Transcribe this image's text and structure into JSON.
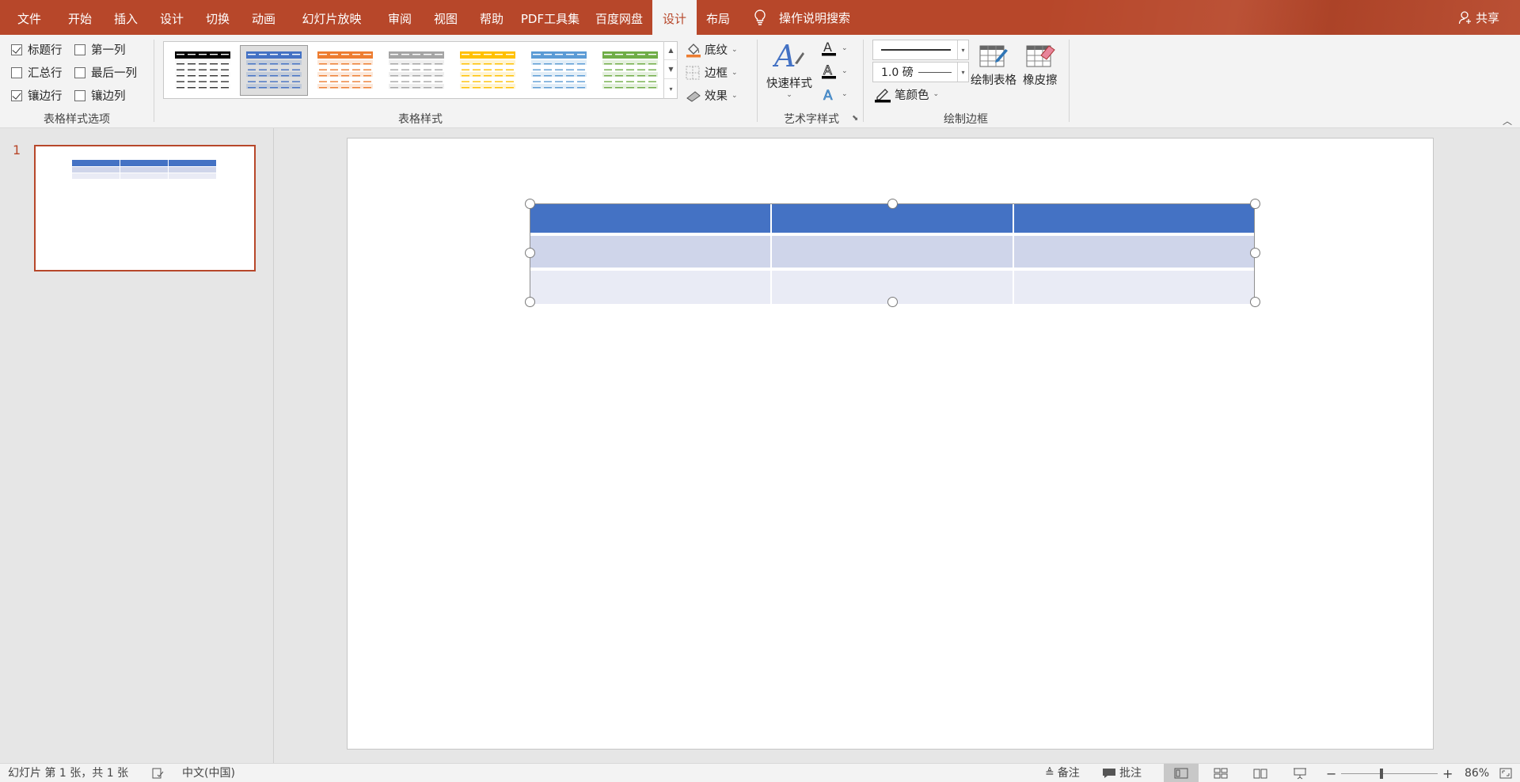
{
  "tabs": [
    {
      "label": "文件",
      "active": false
    },
    {
      "label": "开始",
      "active": false
    },
    {
      "label": "插入",
      "active": false
    },
    {
      "label": "设计",
      "active": false
    },
    {
      "label": "切换",
      "active": false
    },
    {
      "label": "动画",
      "active": false
    },
    {
      "label": "幻灯片放映",
      "active": false
    },
    {
      "label": "审阅",
      "active": false
    },
    {
      "label": "视图",
      "active": false
    },
    {
      "label": "帮助",
      "active": false
    },
    {
      "label": "PDF工具集",
      "active": false
    },
    {
      "label": "百度网盘",
      "active": false
    },
    {
      "label": "设计",
      "active": true
    },
    {
      "label": "布局",
      "active": false
    }
  ],
  "tell_me": "操作说明搜索",
  "share": "共享",
  "style_options": {
    "group_label": "表格样式选项",
    "items": [
      {
        "label": "标题行",
        "checked": true
      },
      {
        "label": "第一列",
        "checked": false
      },
      {
        "label": "汇总行",
        "checked": false
      },
      {
        "label": "最后一列",
        "checked": false
      },
      {
        "label": "镶边行",
        "checked": true
      },
      {
        "label": "镶边列",
        "checked": false
      }
    ]
  },
  "table_styles": {
    "group_label": "表格样式",
    "colors": [
      "#000000",
      "#4472c4",
      "#ed7d31",
      "#a5a5a5",
      "#ffc000",
      "#5b9bd5",
      "#70ad47"
    ],
    "selected_index": 1
  },
  "shading": {
    "shading": "底纹",
    "borders": "边框",
    "effects": "效果"
  },
  "wordart": {
    "group_label": "艺术字样式",
    "quick_styles": "快速样式"
  },
  "draw_borders": {
    "group_label": "绘制边框",
    "pen_weight": "1.0 磅",
    "pen_color": "笔颜色",
    "draw_table": "绘制表格",
    "eraser": "橡皮擦"
  },
  "thumbnail": {
    "slide_number": "1"
  },
  "table": {
    "header_color": "#4472c4",
    "band1_color": "#cfd5ea",
    "band2_color": "#e9ebf5",
    "rows": 3,
    "cols": 3
  },
  "status": {
    "slide_info": "幻灯片 第 1 张，共 1 张",
    "language": "中文(中国)",
    "notes": "备注",
    "comments": "批注",
    "zoom": "86%"
  }
}
